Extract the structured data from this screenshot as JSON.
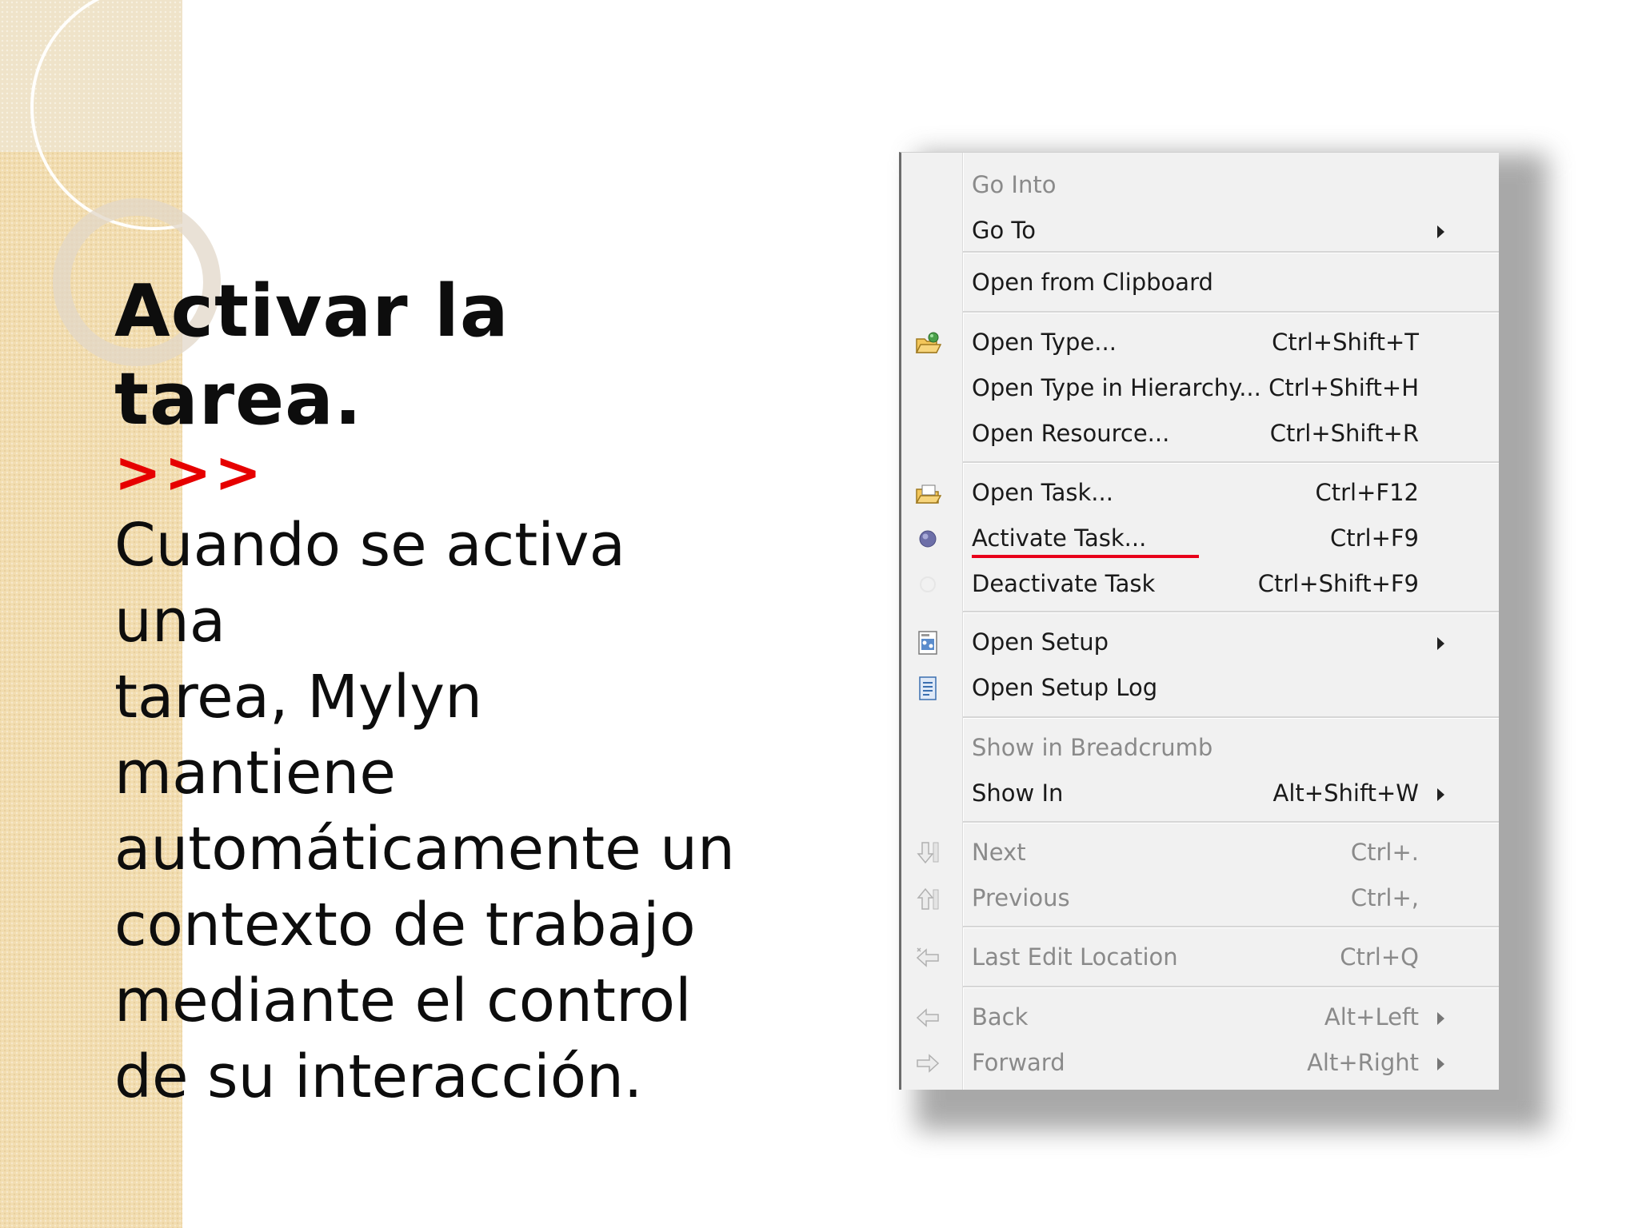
{
  "slide": {
    "title": "Activar la tarea.",
    "arrows": ">>>",
    "body_lines": [
      "Cuando se activa una",
      "tarea, Mylyn",
      "mantiene",
      "automáticamente un",
      "contexto de trabajo",
      "mediante el control",
      "de su interacción."
    ]
  },
  "menu": {
    "items": [
      {
        "label": "Go Into",
        "shortcut": "",
        "disabled": true,
        "icon": ""
      },
      {
        "label": "Go To",
        "shortcut": "",
        "disabled": false,
        "submenu": true,
        "icon": ""
      },
      {
        "label": "Open from Clipboard",
        "shortcut": "",
        "disabled": false,
        "icon": ""
      },
      {
        "label": "Open Type...",
        "shortcut": "Ctrl+Shift+T",
        "disabled": false,
        "icon": "open-type-icon"
      },
      {
        "label": "Open Type in Hierarchy...",
        "shortcut": "Ctrl+Shift+H",
        "disabled": false,
        "icon": ""
      },
      {
        "label": "Open Resource...",
        "shortcut": "Ctrl+Shift+R",
        "disabled": false,
        "icon": ""
      },
      {
        "label": "Open Task...",
        "shortcut": "Ctrl+F12",
        "disabled": false,
        "icon": "open-task-icon"
      },
      {
        "label": "Activate Task...",
        "shortcut": "Ctrl+F9",
        "disabled": false,
        "icon": "activate-task-icon"
      },
      {
        "label": "Deactivate Task",
        "shortcut": "Ctrl+Shift+F9",
        "disabled": false,
        "icon": "deactivate-task-icon"
      },
      {
        "label": "Open Setup",
        "shortcut": "",
        "disabled": false,
        "submenu": true,
        "icon": "open-setup-icon"
      },
      {
        "label": "Open Setup Log",
        "shortcut": "",
        "disabled": false,
        "icon": "setup-log-icon"
      },
      {
        "label": "Show in Breadcrumb",
        "shortcut": "",
        "disabled": true,
        "icon": ""
      },
      {
        "label": "Show In",
        "shortcut": "Alt+Shift+W",
        "disabled": false,
        "submenu": true,
        "icon": ""
      },
      {
        "label": "Next",
        "shortcut": "Ctrl+.",
        "disabled": true,
        "icon": "next-icon"
      },
      {
        "label": "Previous",
        "shortcut": "Ctrl+,",
        "disabled": true,
        "icon": "previous-icon"
      },
      {
        "label": "Last Edit Location",
        "shortcut": "Ctrl+Q",
        "disabled": true,
        "icon": "last-edit-location-icon"
      },
      {
        "label": "Back",
        "shortcut": "Alt+Left",
        "disabled": true,
        "submenu": true,
        "icon": "back-icon"
      },
      {
        "label": "Forward",
        "shortcut": "Alt+Right",
        "disabled": true,
        "submenu": true,
        "icon": "forward-icon"
      }
    ],
    "highlight_color": "#e8001a"
  }
}
